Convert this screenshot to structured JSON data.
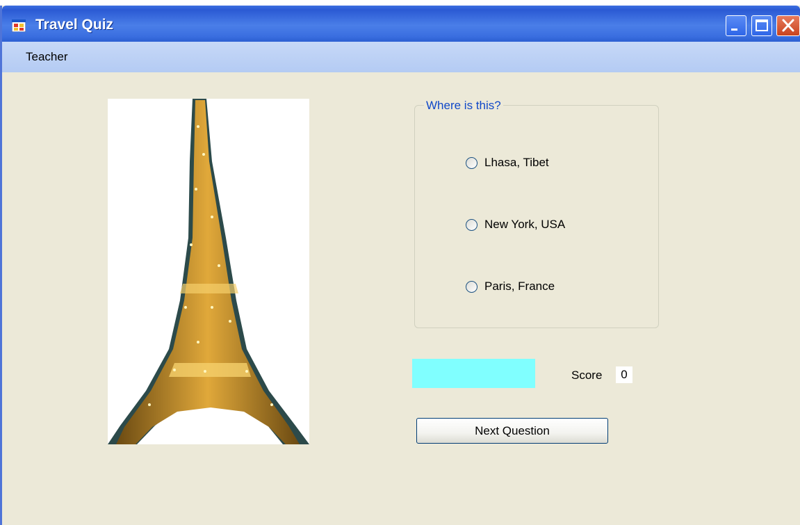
{
  "window": {
    "title": "Travel Quiz",
    "icons": {
      "app": "app-form-icon",
      "minimize": "minimize-icon",
      "maximize": "maximize-icon",
      "close": "close-icon"
    }
  },
  "menubar": {
    "items": [
      {
        "label": "Teacher"
      }
    ]
  },
  "quiz": {
    "picture": "eiffel-tower-picture",
    "question": "Where is this?",
    "options": [
      {
        "label": "Lhasa, Tibet",
        "selected": false
      },
      {
        "label": "New York, USA",
        "selected": false
      },
      {
        "label": "Paris, France",
        "selected": false
      }
    ],
    "answer_box_color": "#80ffff",
    "score_label": "Score",
    "score_value": "0",
    "next_button": "Next Question"
  }
}
